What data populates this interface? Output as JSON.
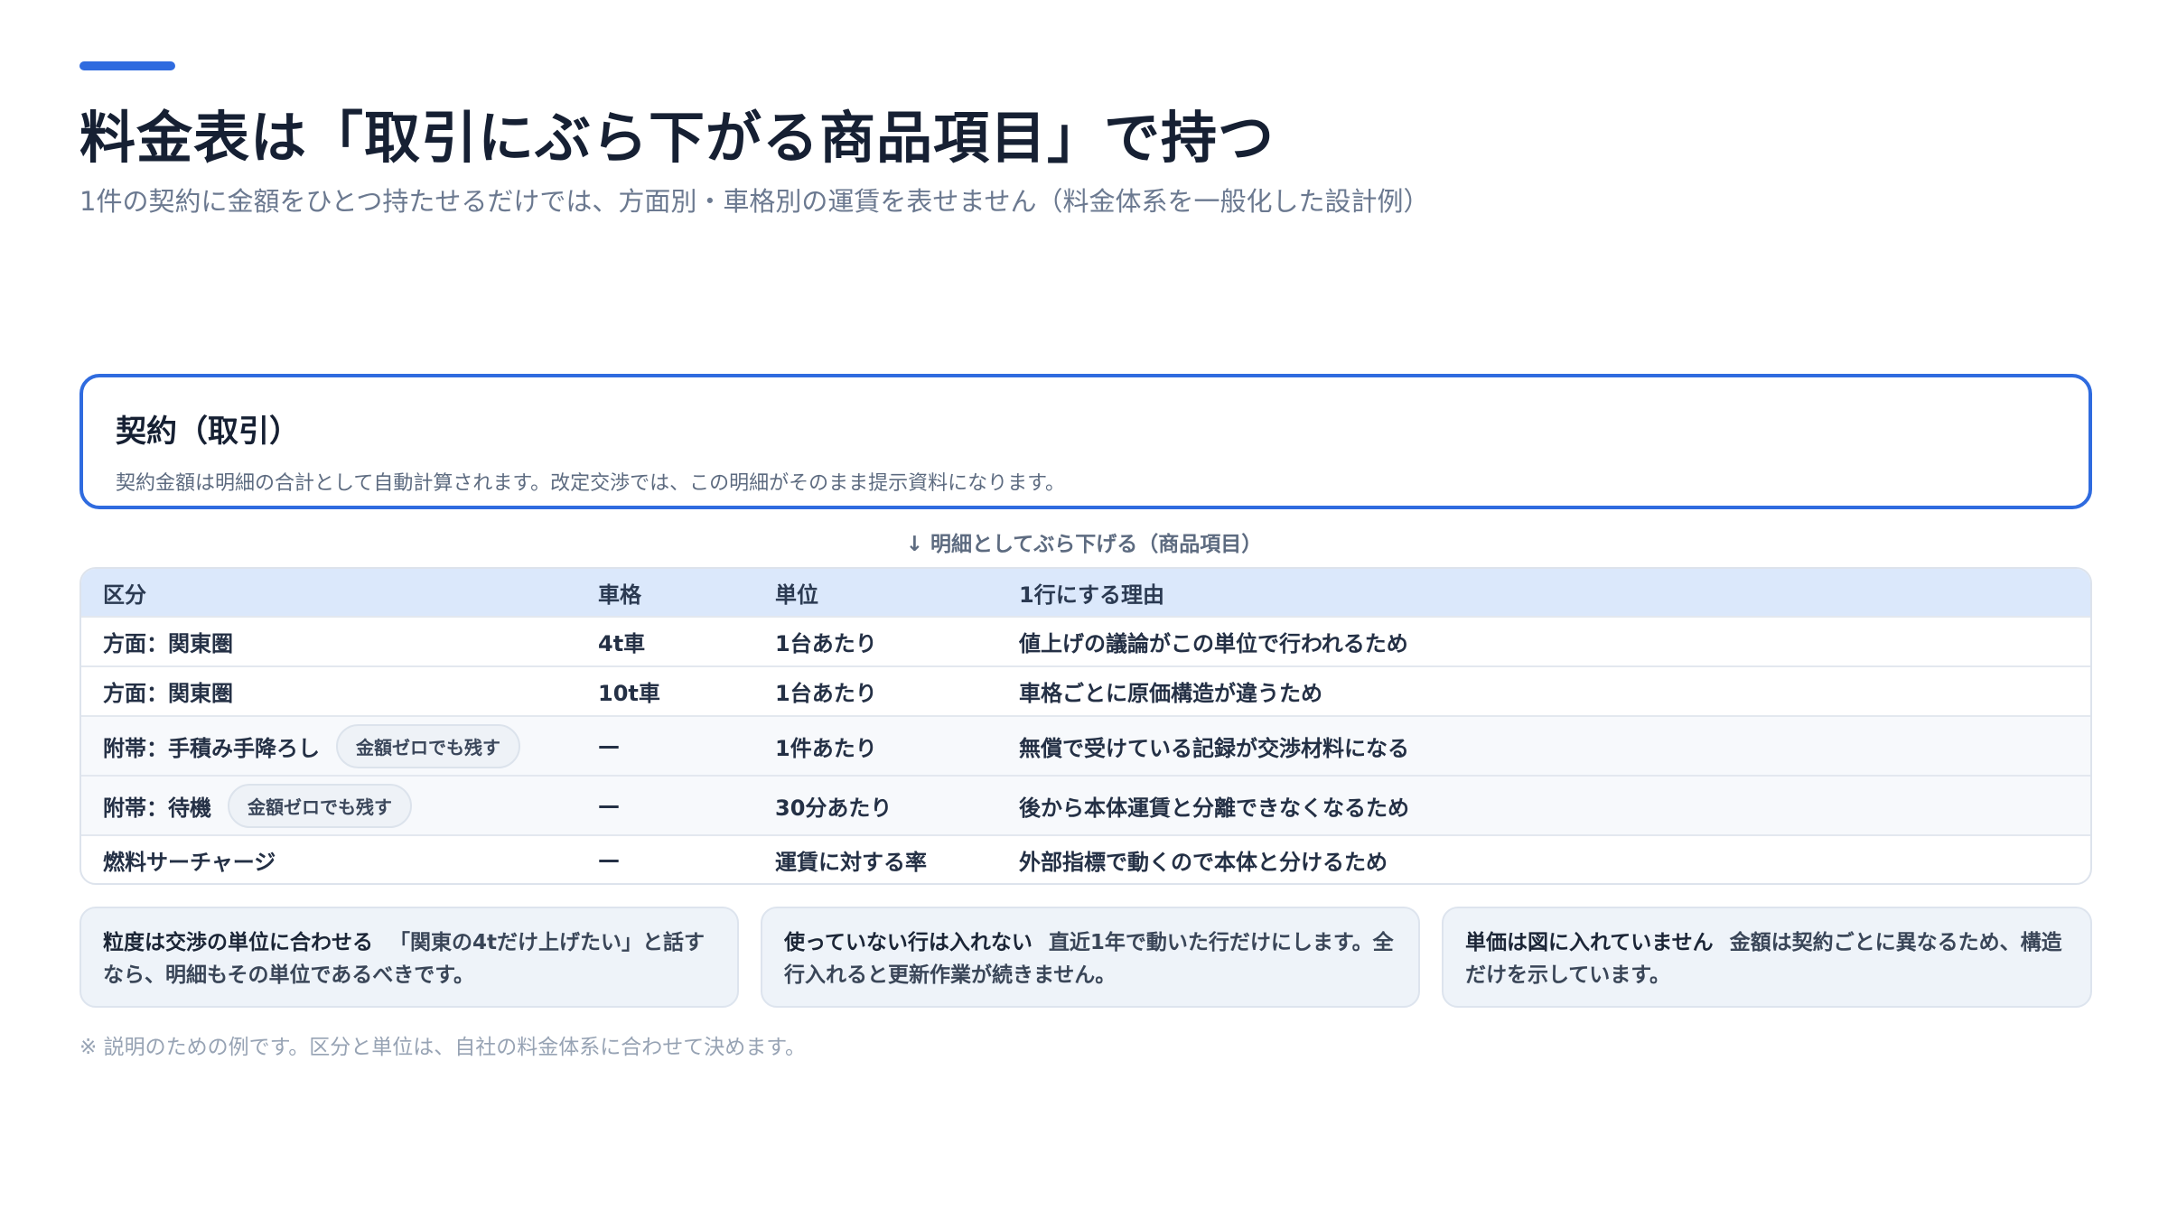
{
  "header": {
    "title": "料金表は「取引にぶら下がる商品項目」で持つ",
    "subtitle": "1件の契約に金額をひとつ持たせるだけでは、方面別・車格別の運賃を表せません（料金体系を一般化した設計例）",
    "accent_color": "#2f6bdf"
  },
  "contract": {
    "title": "契約（取引）",
    "description": "契約金額は明細の合計として自動計算されます。改定交渉では、この明細がそのまま提示資料になります。"
  },
  "connector_label": "↓ 明細としてぶら下げる（商品項目）",
  "table": {
    "columns": [
      "区分",
      "車格",
      "単位",
      "1行にする理由"
    ],
    "rows": [
      {
        "category": "方面：関東圏",
        "badge": "",
        "vehicle": "4t車",
        "unit": "1台あたり",
        "reason": "値上げの議論がこの単位で行われるため"
      },
      {
        "category": "方面：関東圏",
        "badge": "",
        "vehicle": "10t車",
        "unit": "1台あたり",
        "reason": "車格ごとに原価構造が違うため"
      },
      {
        "category": "附帯：手積み手降ろし",
        "badge": "金額ゼロでも残す",
        "vehicle": "—",
        "unit": "1件あたり",
        "reason": "無償で受けている記録が交渉材料になる"
      },
      {
        "category": "附帯：待機",
        "badge": "金額ゼロでも残す",
        "vehicle": "—",
        "unit": "30分あたり",
        "reason": "後から本体運賃と分離できなくなるため"
      },
      {
        "category": "燃料サーチャージ",
        "badge": "",
        "vehicle": "—",
        "unit": "運賃に対する率",
        "reason": "外部指標で動くので本体と分けるため"
      }
    ]
  },
  "notes": [
    {
      "lead": "粒度は交渉の単位に合わせる",
      "text": "「関東の4tだけ上げたい」と話すなら、明細もその単位であるべきです。"
    },
    {
      "lead": "使っていない行は入れない",
      "text": "直近1年で動いた行だけにします。全行入れると更新作業が続きません。"
    },
    {
      "lead": "単価は図に入れていません",
      "text": "金額は契約ごとに異なるため、構造だけを示しています。"
    }
  ],
  "footnote": "※ 説明のための例です。区分と単位は、自社の料金体系に合わせて決めます。"
}
